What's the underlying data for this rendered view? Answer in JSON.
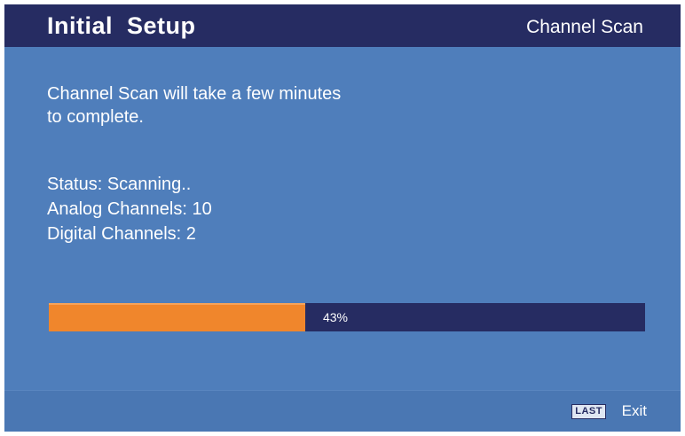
{
  "header": {
    "title": "Initial  Setup",
    "section": "Channel Scan"
  },
  "message": {
    "line1": "Channel Scan will take a few minutes",
    "line2": "to complete."
  },
  "status": {
    "status_line": "Status: Scanning..",
    "analog_line": "Analog Channels: 10",
    "digital_line": "Digital Channels: 2"
  },
  "progress": {
    "percent": 43,
    "label": "43%"
  },
  "footer": {
    "key_label": "LAST",
    "action_label": "Exit"
  },
  "colors": {
    "background": "#4f7ebb",
    "header_bar": "#262c62",
    "progress_track": "#262c62",
    "progress_fill": "#f0862c",
    "text": "#ffffff"
  }
}
